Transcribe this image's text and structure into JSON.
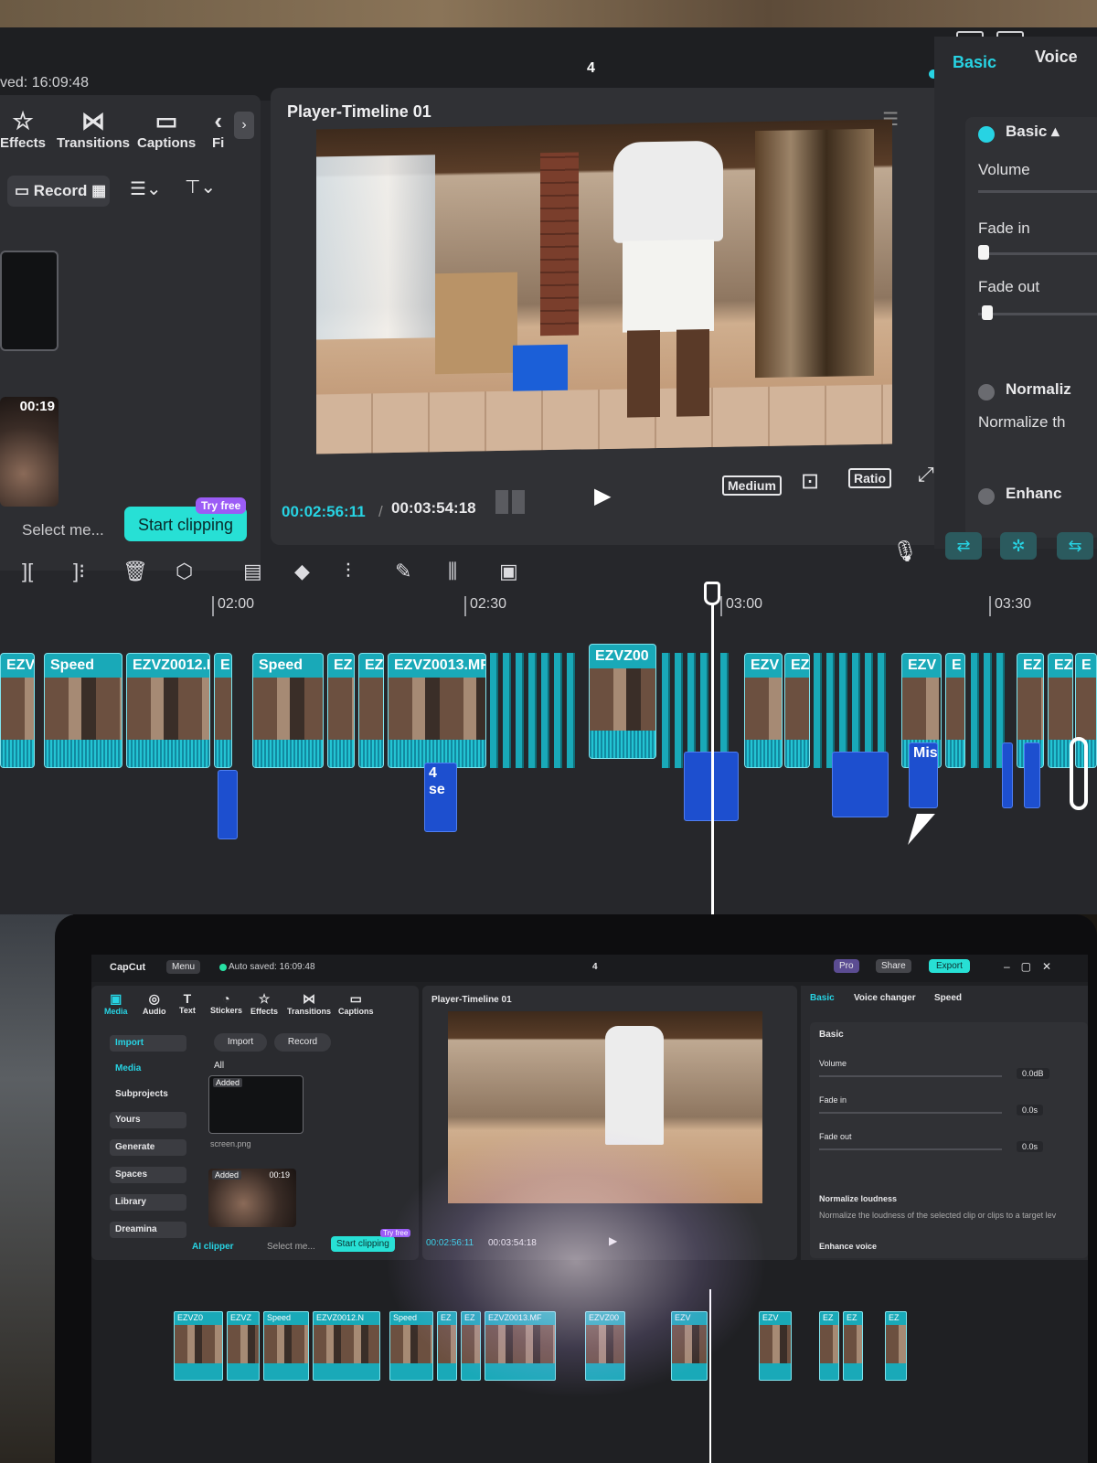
{
  "top": {
    "saved_text": "ved: 16:09:48",
    "center_number": "4",
    "toolbar_tabs": [
      {
        "label": "Effects",
        "icon": "effects-icon"
      },
      {
        "label": "Transitions",
        "icon": "transitions-icon"
      },
      {
        "label": "Captions",
        "icon": "captions-icon"
      },
      {
        "label": "Fi",
        "icon": "filters-icon"
      }
    ],
    "record_label": "Record",
    "select_me": "Select me...",
    "start_clipping": "Start clipping",
    "try_free": "Try free",
    "thumb_duration": "00:19",
    "player": {
      "title": "Player-Timeline 01",
      "current_time": "00:02:56:11",
      "separator": "/",
      "total_time": "00:03:54:18",
      "quality": "Medium",
      "ratio": "Ratio"
    },
    "right_panel": {
      "tabs": [
        "Basic",
        "Voice"
      ],
      "section": "Basic",
      "volume": "Volume",
      "fade_in": "Fade in",
      "fade_out": "Fade out",
      "normalize_title": "Normaliz",
      "normalize_desc": "Normalize th",
      "enhance": "Enhanc"
    },
    "ruler": [
      "02:00",
      "02:30",
      "03:00",
      "03:30"
    ],
    "clips": [
      {
        "name": "EZVZ"
      },
      {
        "name": "Speed"
      },
      {
        "name": "EZVZ0012.M"
      },
      {
        "name": "E"
      },
      {
        "name": "Speed"
      },
      {
        "name": "EZ"
      },
      {
        "name": "EZ"
      },
      {
        "name": "EZVZ0013.MF"
      },
      {
        "name": "EZVZ00"
      },
      {
        "name": "EZV"
      },
      {
        "name": "EZ"
      },
      {
        "name": "EZV"
      },
      {
        "name": "E"
      },
      {
        "name": "EZ"
      },
      {
        "name": "EZ"
      },
      {
        "name": "E"
      }
    ],
    "audio_clips": [
      {
        "name": "4 se"
      },
      {
        "name": "Mis"
      }
    ]
  },
  "laptop": {
    "app_name": "CapCut",
    "menu": "Menu",
    "auto_saved": "Auto saved: 16:09:48",
    "center_number": "4",
    "pro": "Pro",
    "share": "Share",
    "export": "Export",
    "tools": [
      {
        "label": "Media",
        "icon": "media-icon"
      },
      {
        "label": "Audio",
        "icon": "audio-icon"
      },
      {
        "label": "Text",
        "icon": "text-icon"
      },
      {
        "label": "Stickers",
        "icon": "stickers-icon"
      },
      {
        "label": "Effects",
        "icon": "effects-icon"
      },
      {
        "label": "Transitions",
        "icon": "transitions-icon"
      },
      {
        "label": "Captions",
        "icon": "captions-icon"
      }
    ],
    "sidebar": [
      "Import",
      "Media",
      "Subprojects",
      "Yours",
      "Generate",
      "Spaces",
      "Library",
      "Dreamina"
    ],
    "import_btn": "Import",
    "record_btn": "Record",
    "all": "All",
    "added": "Added",
    "thumb1_name": "screen.png",
    "thumb2_duration": "00:19",
    "ai_clipper": "AI clipper",
    "select_me": "Select me...",
    "start_clipping": "Start clipping",
    "try_free": "Try free",
    "player_title": "Player-Timeline 01",
    "current_time": "00:02:56:11",
    "total_time": "00:03:54:18",
    "right_tabs": [
      "Basic",
      "Voice changer",
      "Speed"
    ],
    "basic": "Basic",
    "volume": "Volume",
    "volume_value": "0.0dB",
    "fade_in": "Fade in",
    "fade_in_value": "0.0s",
    "fade_out": "Fade out",
    "fade_out_value": "0.0s",
    "normalize": "Normalize loudness",
    "normalize_desc": "Normalize the loudness of the selected clip or clips to a target lev",
    "enhance": "Enhance voice",
    "clips": [
      "EZVZ0",
      "EZVZ",
      "Speed",
      "EZVZ0012.N",
      "Speed",
      "EZ",
      "EZ",
      "EZVZ0013.MF",
      "EZVZ00",
      "EZV",
      "EZV",
      "EZ",
      "EZ",
      "EZ"
    ]
  },
  "colors": {
    "accent": "#27d3e3",
    "clip": "#19a9b8",
    "audio": "#1d4fcf",
    "try_free": "#9b5cf6"
  }
}
